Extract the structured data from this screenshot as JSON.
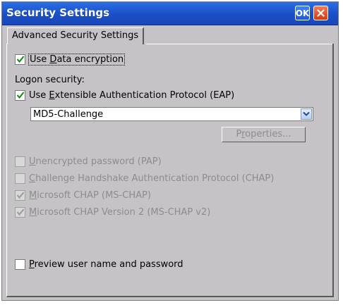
{
  "window": {
    "title": "Security Settings",
    "ok_label": "OK",
    "title_color": "#1b4fc6"
  },
  "tabs": [
    {
      "label": "Advanced Security Settings",
      "selected": true
    }
  ],
  "options": {
    "use_data_encryption": {
      "label_pre": "Use ",
      "mnemonic": "D",
      "label_post": "ata encryption",
      "checked": true,
      "enabled": true
    },
    "logon_security_label": "Logon security:",
    "use_eap": {
      "label_pre": "Use ",
      "mnemonic": "E",
      "label_post": "xtensible Authentication Protocol (EAP)",
      "checked": true,
      "enabled": true
    },
    "eap_method": {
      "value": "MD5-Challenge"
    },
    "properties_button": {
      "label_pre": "P",
      "mnemonic": "r",
      "label_post": "operties...",
      "enabled": false
    },
    "pap": {
      "mnemonic": "U",
      "label_post": "nencrypted password (PAP)",
      "checked": false,
      "enabled": false
    },
    "chap": {
      "mnemonic": "C",
      "label_post": "hallenge Handshake Authentication Protocol (CHAP)",
      "checked": false,
      "enabled": false
    },
    "mschap": {
      "mnemonic": "M",
      "label_post": "icrosoft CHAP (MS-CHAP)",
      "checked": true,
      "enabled": false
    },
    "mschapv2": {
      "mnemonic": "M",
      "label_post": "icrosoft CHAP Version 2 (MS-CHAP v2)",
      "checked": true,
      "enabled": false
    },
    "preview": {
      "mnemonic": "P",
      "label_post": "review user name and password",
      "checked": false,
      "enabled": true
    }
  }
}
